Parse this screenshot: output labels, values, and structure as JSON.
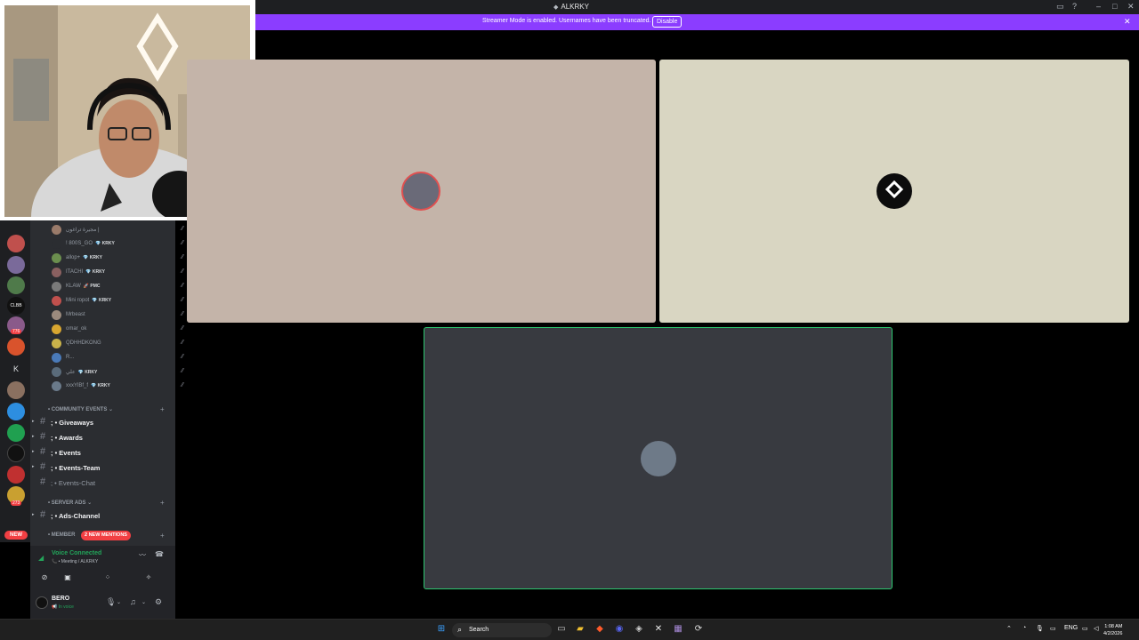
{
  "window": {
    "title": "ALKRKY",
    "controls": [
      "picture-in-picture-icon",
      "help-icon",
      "minimize-icon",
      "maximize-icon",
      "close-icon"
    ]
  },
  "banner": {
    "message": "Streamer Mode is enabled. Usernames have been truncated.",
    "action": "Disable"
  },
  "rail": {
    "badges": [
      "776",
      "273"
    ],
    "letter_server": "K",
    "new_label": "NEW"
  },
  "members": [
    {
      "name": "مجيرة تراغون |",
      "tag": "",
      "color": "#9a7b6a"
    },
    {
      "name": "! 800S_GO",
      "tag": "💎 KRKY",
      "color": "#2b2d31"
    },
    {
      "name": "allop+",
      "tag": "💎 KRKY",
      "color": "#6b8e4e"
    },
    {
      "name": "ITACHI",
      "tag": "💎 KRKY",
      "color": "#8a6060"
    },
    {
      "name": "KLAW",
      "tag": "🚀 PMC",
      "color": "#7a7a7a"
    },
    {
      "name": "Mini ropot",
      "tag": "💎 KRKY",
      "color": "#c0504d"
    },
    {
      "name": "Mrbeast",
      "tag": "",
      "color": "#9b8a7d"
    },
    {
      "name": "omar_ok",
      "tag": "",
      "color": "#d8a630"
    },
    {
      "name": "QDHHDKONG",
      "tag": "",
      "color": "#c9b24a"
    },
    {
      "name": "R...",
      "tag": "",
      "color": "#4a7ab8"
    },
    {
      "name": "علي",
      "tag": "💎 KRKY",
      "color": "#5a6b7a"
    },
    {
      "name": "xxxYlBf_f",
      "tag": "💎 KRKY",
      "color": "#6a7a8a"
    }
  ],
  "categories": {
    "community": "• COMMUNITY EVENTS ⌄",
    "server_ads": "• SERVER ADS ⌄",
    "members": "• MEMBER"
  },
  "channels": {
    "community": [
      {
        "label": "; • Giveaways",
        "muted": false
      },
      {
        "label": "; • Awards",
        "muted": false
      },
      {
        "label": "; • Events",
        "muted": false
      },
      {
        "label": "; • Events-Team",
        "muted": false
      },
      {
        "label": "; • Events-Chat",
        "muted": true
      }
    ],
    "server_ads": [
      {
        "label": "; • Ads-Channel",
        "muted": false
      }
    ]
  },
  "mentions_pill": "2 NEW MENTIONS",
  "voice": {
    "status": "Voice Connected",
    "location": "📞 • Meeting / ALKRKY"
  },
  "user": {
    "name": "BERO",
    "status": "📢 In voice"
  },
  "taskbar": {
    "search": "Search",
    "lang": "ENG",
    "time": "1:08 AM",
    "date": "4/2/2026"
  },
  "colors": {
    "accent_purple": "#8b3dff",
    "voice_green": "#23a55a",
    "alert_red": "#f23f43",
    "speaking_border": "#2dc770"
  }
}
